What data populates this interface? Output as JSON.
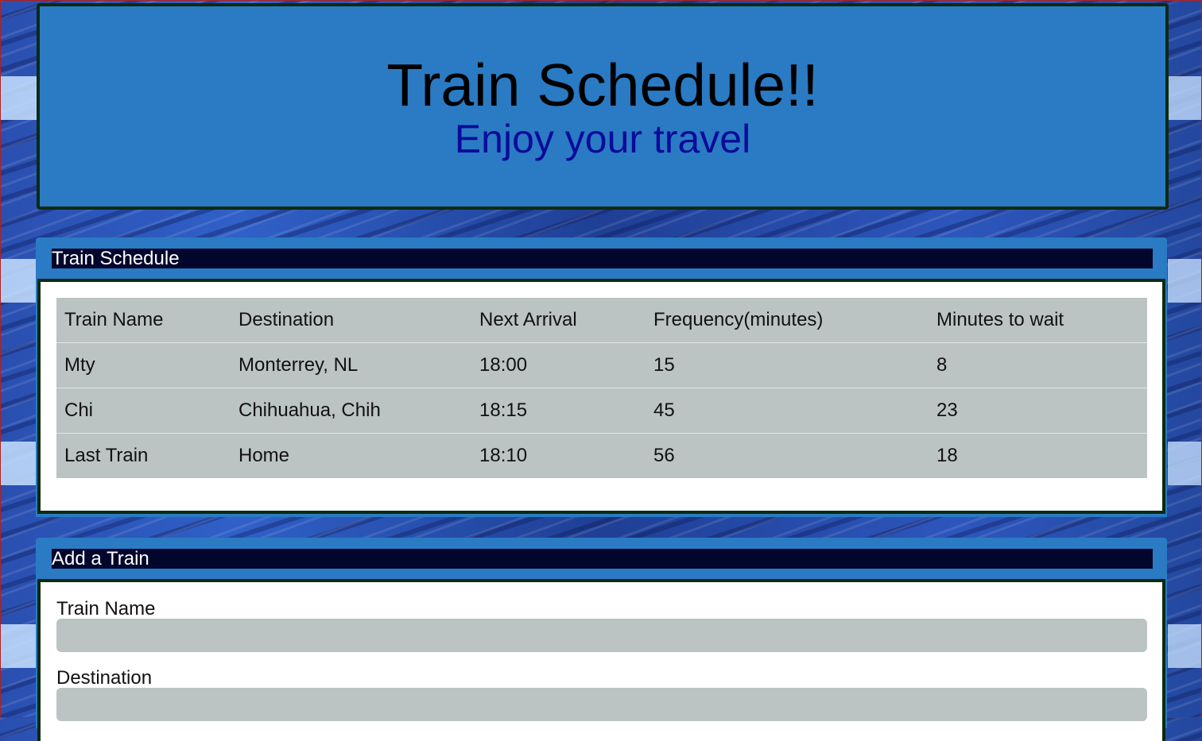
{
  "header": {
    "title": "Train Schedule!!",
    "subtitle": "Enjoy your travel"
  },
  "schedule": {
    "heading": "Train Schedule",
    "columns": [
      "Train Name",
      "Destination",
      "Next Arrival",
      "Frequency(minutes)",
      "Minutes to wait"
    ],
    "rows": [
      [
        "Mty",
        "Monterrey, NL",
        "18:00",
        "15",
        "8"
      ],
      [
        "Chi",
        "Chihuahua, Chih",
        "18:15",
        "45",
        "23"
      ],
      [
        "Last Train",
        "Home",
        "18:10",
        "56",
        "18"
      ]
    ]
  },
  "add_train": {
    "heading": "Add a Train",
    "train_name_label": "Train Name",
    "train_name_value": "",
    "destination_label": "Destination",
    "destination_value": ""
  },
  "colors": {
    "panel_blue": "#2a7bc3",
    "heading_navy": "#02062c",
    "table_gray": "#bcc3c3",
    "subtitle_blue": "#0b0b9a"
  }
}
